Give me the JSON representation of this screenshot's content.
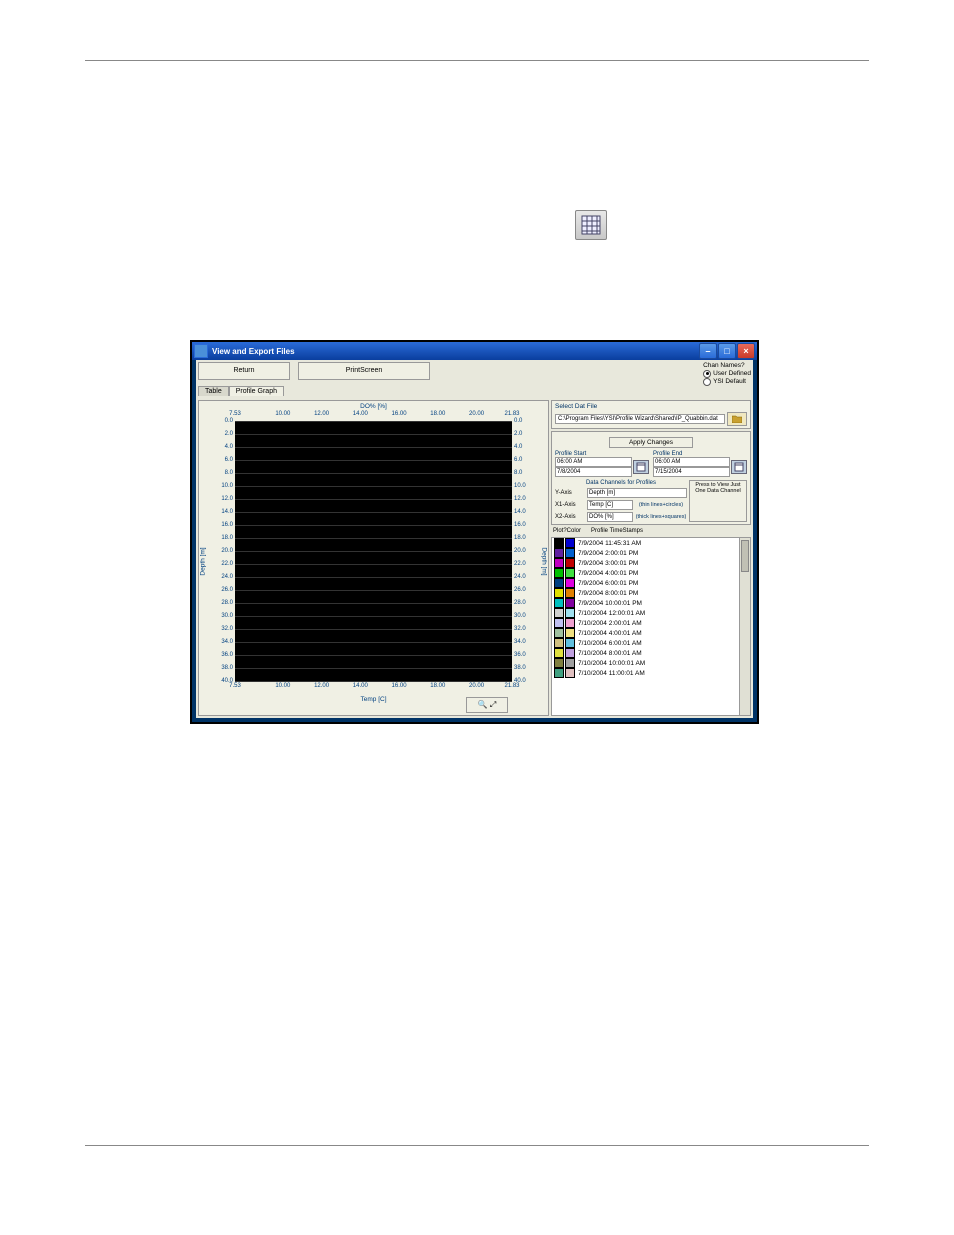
{
  "prose_icon_name": "grid-icon",
  "window": {
    "title": "View and Export Files",
    "buttons": {
      "return": "Return",
      "printscreen": "PrintScreen"
    },
    "tabs": {
      "table": "Table",
      "profile_graph": "Profile Graph"
    },
    "chan_names": {
      "title": "Chan Names?",
      "user_defined": "User Defined",
      "ysi_default": "YSI Default"
    }
  },
  "right": {
    "select_dat": "Select Dat File",
    "file_path": "C:\\Program Files\\YSI\\Profile Wizard\\Shared\\IP_Quabbin.dat",
    "apply": "Apply Changes",
    "profile_start": "Profile Start",
    "profile_end": "Profile End",
    "start_time": "06:00 AM",
    "start_date": "7/8/2004",
    "end_time": "06:00 AM",
    "end_date": "7/15/2004",
    "data_channels": "Data Channels for Profiles",
    "press_view": "Press to View Just One Data Channel",
    "y_axis": "Y-Axis",
    "x1_axis": "X1-Axis",
    "x2_axis": "X2-Axis",
    "y_val": "Depth [m]",
    "x1_val": "Temp [C]",
    "x2_val": "DO% [%]",
    "x1_hint": "(thin lines+circles)",
    "x2_hint": "(thick lines+squares)",
    "plot_color": "Plot?Color",
    "timestamps_header": "Profile TimeStamps",
    "timestamps": [
      {
        "c1": "#000000",
        "c2": "#0000d0",
        "t": "7/9/2004 11:45:31 AM"
      },
      {
        "c1": "#6020a0",
        "c2": "#0060d0",
        "t": "7/9/2004 2:00:01 PM"
      },
      {
        "c1": "#c000c0",
        "c2": "#c00000",
        "t": "7/9/2004 3:00:01 PM"
      },
      {
        "c1": "#00c000",
        "c2": "#40e040",
        "t": "7/9/2004 4:00:01 PM"
      },
      {
        "c1": "#004080",
        "c2": "#e000e0",
        "t": "7/9/2004 6:00:01 PM"
      },
      {
        "c1": "#e0e000",
        "c2": "#e08000",
        "t": "7/9/2004 8:00:01 PM"
      },
      {
        "c1": "#00c0c0",
        "c2": "#8000a0",
        "t": "7/9/2004 10:00:01 PM"
      },
      {
        "c1": "#d0d0d0",
        "c2": "#a0e0f0",
        "t": "7/10/2004 12:00:01 AM"
      },
      {
        "c1": "#c0c0f0",
        "c2": "#f0a0d0",
        "t": "7/10/2004 2:00:01 AM"
      },
      {
        "c1": "#a0c0a0",
        "c2": "#f0e080",
        "t": "7/10/2004 4:00:01 AM"
      },
      {
        "c1": "#d0c080",
        "c2": "#60c0e0",
        "t": "7/10/2004 6:00:01 AM"
      },
      {
        "c1": "#e0e040",
        "c2": "#c0a0e0",
        "t": "7/10/2004 8:00:01 AM"
      },
      {
        "c1": "#808040",
        "c2": "#a0a0a0",
        "t": "7/10/2004 10:00:01 AM"
      },
      {
        "c1": "#40a080",
        "c2": "#e0c0c0",
        "t": "7/10/2004 11:00:01 AM"
      }
    ]
  },
  "chart_data": {
    "type": "line",
    "title": "",
    "top_axis_label": "DO% [%]",
    "bottom_axis_label": "Temp [C]",
    "left_axis_label": "Depth [m]",
    "right_axis_label": "Depth [m]",
    "x_ticks": [
      7.53,
      10.0,
      12.0,
      14.0,
      16.0,
      18.0,
      20.0,
      21.83
    ],
    "y_left_ticks": [
      0.0,
      2.0,
      4.0,
      6.0,
      8.0,
      10.0,
      12.0,
      14.0,
      16.0,
      18.0,
      20.0,
      22.0,
      24.0,
      26.0,
      28.0,
      30.0,
      32.0,
      34.0,
      36.0,
      38.0,
      40.0
    ],
    "y_right_ticks": [
      0.0,
      2.0,
      4.0,
      6.0,
      8.0,
      10.0,
      12.0,
      14.0,
      16.0,
      18.0,
      20.0,
      22.0,
      24.0,
      26.0,
      28.0,
      30.0,
      32.0,
      34.0,
      36.0,
      38.0,
      40.0
    ],
    "ylim": [
      0,
      40
    ],
    "xlim": [
      7.53,
      21.83
    ],
    "series": []
  }
}
